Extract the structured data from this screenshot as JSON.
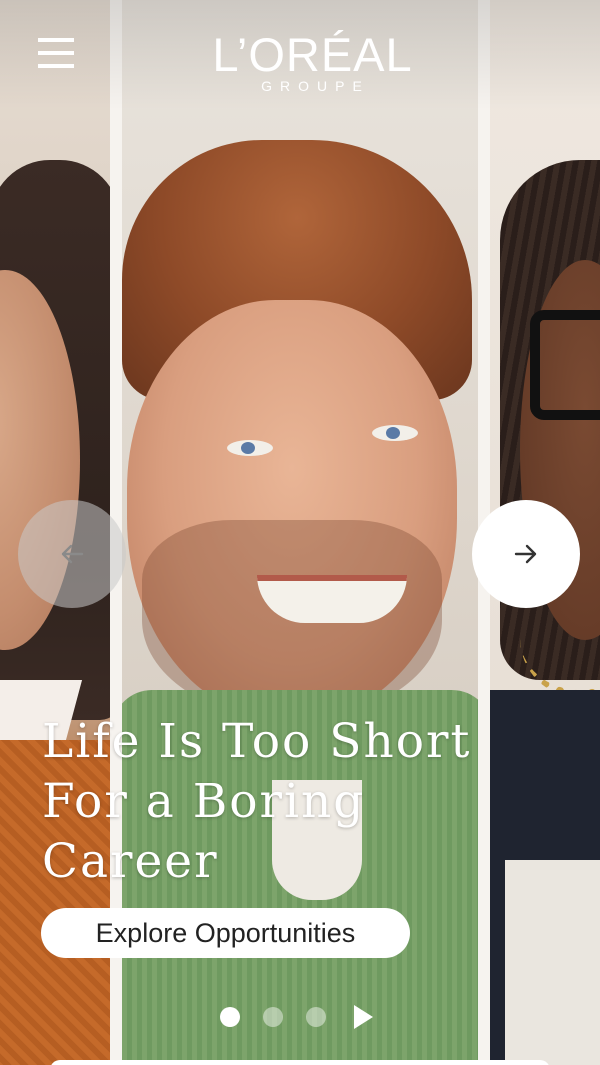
{
  "header": {
    "menu_icon": "hamburger-menu-icon",
    "logo_main": "L’ORÉAL",
    "logo_sub": "GROUPE"
  },
  "carousel": {
    "prev_icon": "arrow-left-icon",
    "next_icon": "arrow-right-icon",
    "headline": "Life Is Too Short\nFor a Boring\nCareer",
    "cta_label": "Explore Opportunities",
    "slide_count": 3,
    "active_slide": 1,
    "play_icon": "play-icon"
  },
  "colors": {
    "text": "#ffffff",
    "cta_background": "#ffffff",
    "cta_text": "#222222",
    "arrow_prev_background": "rgba(200,200,200,0.55)",
    "arrow_next_background": "#ffffff",
    "dot_active": "#ffffff",
    "dot_inactive": "rgba(255,255,255,0.45)"
  }
}
